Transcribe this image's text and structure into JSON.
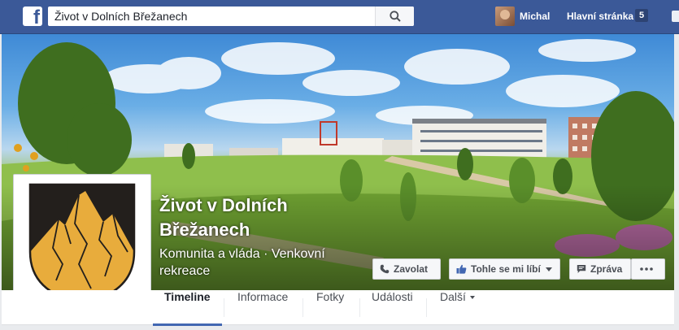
{
  "topbar": {
    "logo_icon": "facebook-logo-icon",
    "search_value": "Život v Dolních Břežanech",
    "search_icon": "search-icon",
    "user_name": "Michal",
    "home_label": "Hlavní stránka",
    "home_count": "5"
  },
  "page": {
    "name": "Život v Dolních Břežanech",
    "category": "Komunita a vláda · Venkovní rekreace",
    "profile_picture": "coat-of-arms-mountains"
  },
  "actions": {
    "call_label": "Zavolat",
    "like_label": "Tohle se mi líbí",
    "message_label": "Zpráva",
    "more_icon": "more-dots-icon"
  },
  "tabs": [
    {
      "label": "Timeline",
      "active": true
    },
    {
      "label": "Informace",
      "active": false
    },
    {
      "label": "Fotky",
      "active": false
    },
    {
      "label": "Události",
      "active": false
    },
    {
      "label": "Další",
      "active": false
    }
  ],
  "colors": {
    "brand_blue": "#3b5998",
    "tab_underline": "#4267b2",
    "emblem_gold": "#e8ac3c",
    "emblem_black": "#231f1c"
  }
}
